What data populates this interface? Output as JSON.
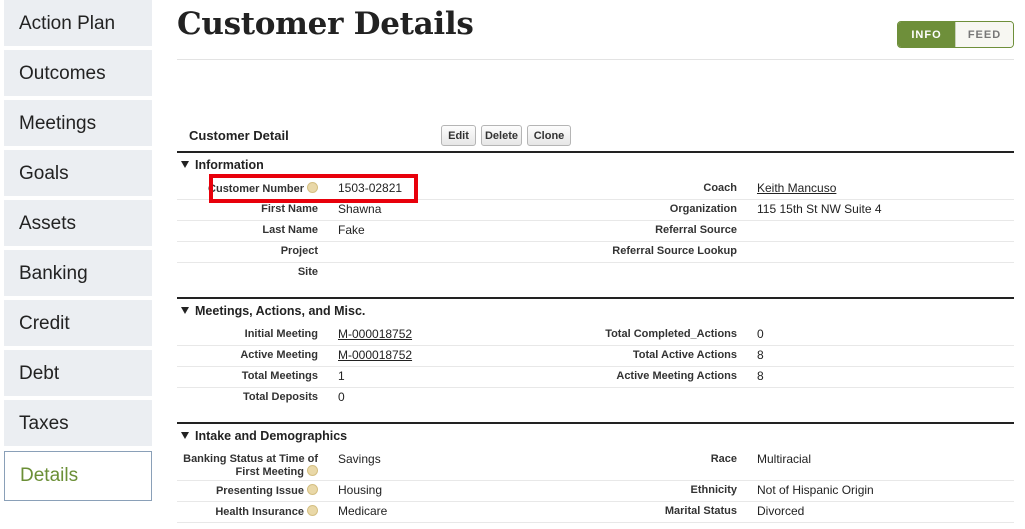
{
  "sidebar": {
    "items": [
      {
        "label": "Action Plan"
      },
      {
        "label": "Outcomes"
      },
      {
        "label": "Meetings"
      },
      {
        "label": "Goals"
      },
      {
        "label": "Assets"
      },
      {
        "label": "Banking"
      },
      {
        "label": "Credit"
      },
      {
        "label": "Debt"
      },
      {
        "label": "Taxes"
      },
      {
        "label": "Details"
      }
    ],
    "active": "Details"
  },
  "header": {
    "title": "Customer Details",
    "toggle": {
      "info": "INFO",
      "feed": "FEED"
    }
  },
  "detail": {
    "title": "Customer Detail",
    "buttons": {
      "edit": "Edit",
      "delete": "Delete",
      "clone": "Clone"
    }
  },
  "sections": {
    "information": {
      "heading": "Information",
      "customer_number_label": "Customer Number",
      "customer_number": "1503-02821",
      "coach_label": "Coach",
      "coach": "Keith Mancuso",
      "first_name_label": "First Name",
      "first_name": "Shawna",
      "organization_label": "Organization",
      "organization": "115 15th St NW Suite 4",
      "last_name_label": "Last Name",
      "last_name": "Fake",
      "referral_source_label": "Referral Source",
      "project_label": "Project",
      "referral_lookup_label": "Referral Source Lookup",
      "site_label": "Site"
    },
    "meetings": {
      "heading": "Meetings, Actions, and Misc.",
      "initial_meeting_label": "Initial Meeting",
      "initial_meeting": "M-000018752",
      "total_completed_label": "Total Completed_Actions",
      "total_completed": "0",
      "active_meeting_label": "Active Meeting",
      "active_meeting": "M-000018752",
      "total_active_label": "Total Active Actions",
      "total_active": "8",
      "total_meetings_label": "Total Meetings",
      "total_meetings": "1",
      "active_meeting_actions_label": "Active Meeting Actions",
      "active_meeting_actions": "8",
      "total_deposits_label": "Total Deposits",
      "total_deposits": "0"
    },
    "intake": {
      "heading": "Intake and Demographics",
      "banking_status_label_1": "Banking Status at Time of",
      "banking_status_label_2": "First Meeting",
      "banking_status": "Savings",
      "race_label": "Race",
      "race": "Multiracial",
      "presenting_issue_label": "Presenting Issue",
      "presenting_issue": "Housing",
      "ethnicity_label": "Ethnicity",
      "ethnicity": "Not of Hispanic Origin",
      "health_insurance_label": "Health Insurance",
      "health_insurance": "Medicare",
      "marital_status_label": "Marital Status",
      "marital_status": "Divorced"
    }
  },
  "colors": {
    "accent_green": "#6e8f3a",
    "highlight_red": "#e8000b",
    "sidebar_bg": "#ebeef2"
  }
}
